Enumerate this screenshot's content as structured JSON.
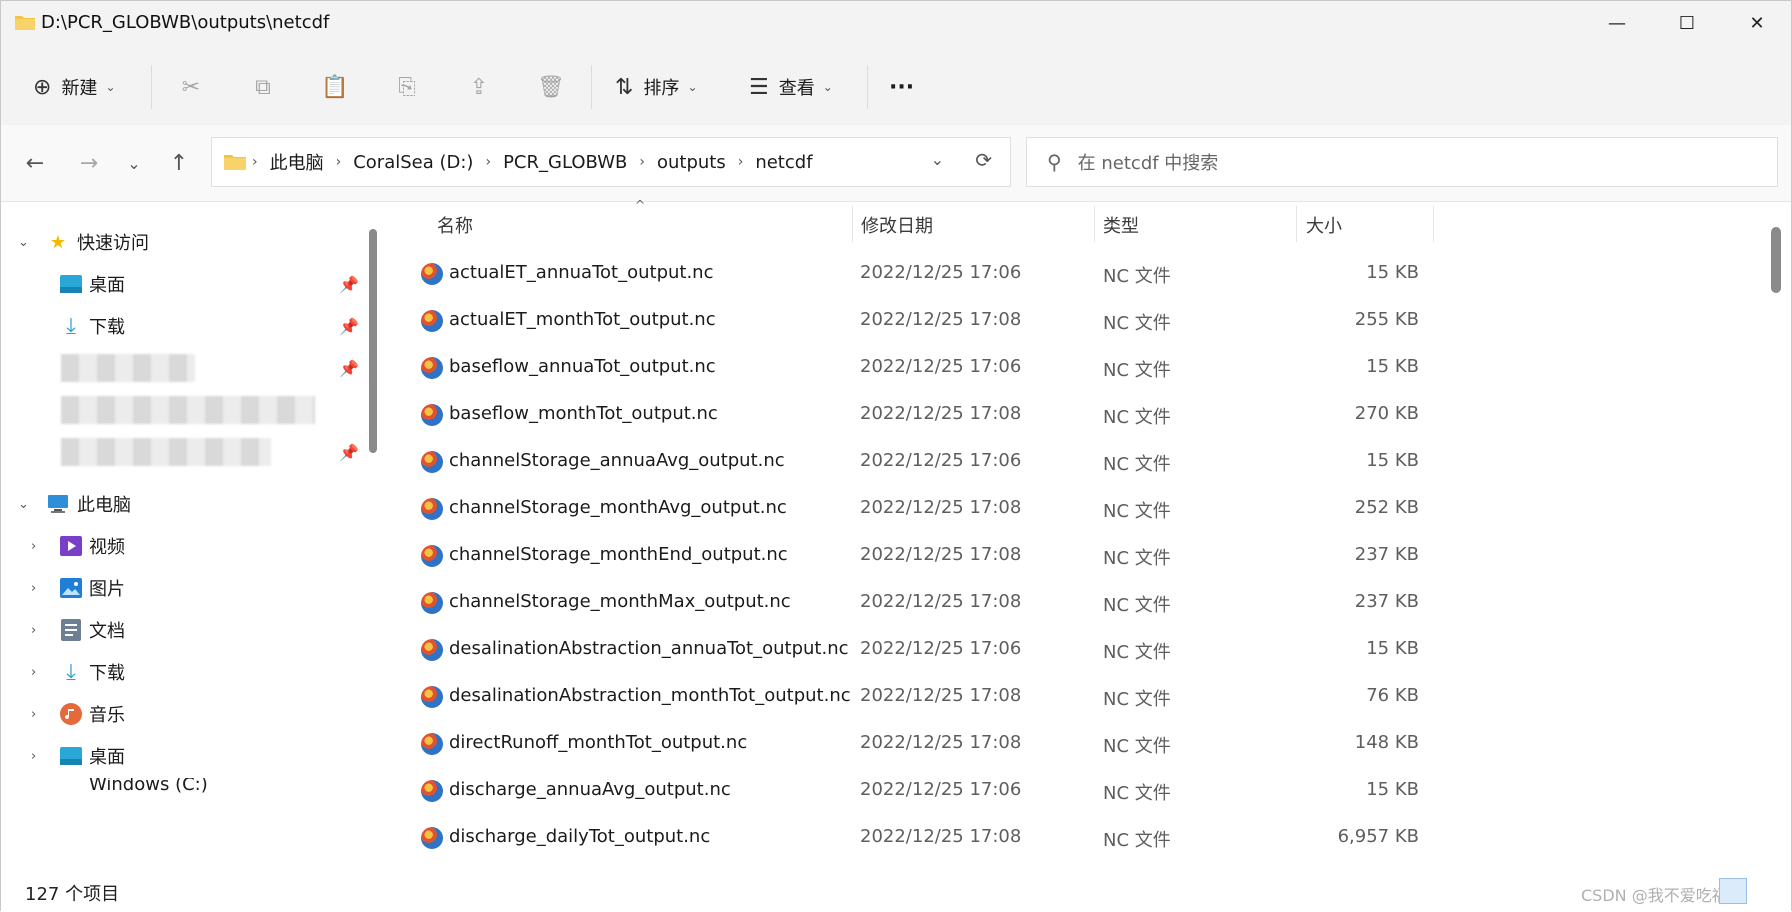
{
  "window": {
    "title": "D:\\PCR_GLOBWB\\outputs\\netcdf"
  },
  "toolbar": {
    "new_label": "新建",
    "sort_label": "排序",
    "view_label": "查看",
    "more_label": "···"
  },
  "icons": {
    "minimize": "—",
    "maximize": "☐",
    "close": "✕",
    "back": "←",
    "forward": "→",
    "recent": "⌄",
    "up": "↑",
    "new": "⊕",
    "cut": "✂",
    "copy": "⧉",
    "paste": "📋",
    "rename": "⎘",
    "share": "⇪",
    "delete": "🗑",
    "sort": "⇅",
    "view": "☰",
    "chevron_down": "⌄",
    "refresh": "⟳",
    "search": "⚲",
    "chevron_right": "›",
    "pin": "📌"
  },
  "address": {
    "crumbs": [
      "此电脑",
      "CoralSea (D:)",
      "PCR_GLOBWB",
      "outputs",
      "netcdf"
    ],
    "separator": "›"
  },
  "search": {
    "placeholder": "在 netcdf 中搜索"
  },
  "nav": {
    "quick_access": "快速访问",
    "quick_items": [
      "桌面",
      "下载"
    ],
    "this_pc": "此电脑",
    "pc_items": [
      "视频",
      "图片",
      "文档",
      "下载",
      "音乐",
      "桌面"
    ],
    "partial_item": "Windows (C:)"
  },
  "columns": {
    "name": "名称",
    "date": "修改日期",
    "type": "类型",
    "size": "大小"
  },
  "files": [
    {
      "name": "actualET_annuaTot_output.nc",
      "date": "2022/12/25 17:06",
      "type": "NC 文件",
      "size": "15 KB"
    },
    {
      "name": "actualET_monthTot_output.nc",
      "date": "2022/12/25 17:08",
      "type": "NC 文件",
      "size": "255 KB"
    },
    {
      "name": "baseflow_annuaTot_output.nc",
      "date": "2022/12/25 17:06",
      "type": "NC 文件",
      "size": "15 KB"
    },
    {
      "name": "baseflow_monthTot_output.nc",
      "date": "2022/12/25 17:08",
      "type": "NC 文件",
      "size": "270 KB"
    },
    {
      "name": "channelStorage_annuaAvg_output.nc",
      "date": "2022/12/25 17:06",
      "type": "NC 文件",
      "size": "15 KB"
    },
    {
      "name": "channelStorage_monthAvg_output.nc",
      "date": "2022/12/25 17:08",
      "type": "NC 文件",
      "size": "252 KB"
    },
    {
      "name": "channelStorage_monthEnd_output.nc",
      "date": "2022/12/25 17:08",
      "type": "NC 文件",
      "size": "237 KB"
    },
    {
      "name": "channelStorage_monthMax_output.nc",
      "date": "2022/12/25 17:08",
      "type": "NC 文件",
      "size": "237 KB"
    },
    {
      "name": "desalinationAbstraction_annuaTot_output.nc",
      "date": "2022/12/25 17:06",
      "type": "NC 文件",
      "size": "15 KB"
    },
    {
      "name": "desalinationAbstraction_monthTot_output.nc",
      "date": "2022/12/25 17:08",
      "type": "NC 文件",
      "size": "76 KB"
    },
    {
      "name": "directRunoff_monthTot_output.nc",
      "date": "2022/12/25 17:08",
      "type": "NC 文件",
      "size": "148 KB"
    },
    {
      "name": "discharge_annuaAvg_output.nc",
      "date": "2022/12/25 17:06",
      "type": "NC 文件",
      "size": "15 KB"
    },
    {
      "name": "discharge_dailyTot_output.nc",
      "date": "2022/12/25 17:08",
      "type": "NC 文件",
      "size": "6,957 KB"
    }
  ],
  "status": {
    "item_count": "127 个项目",
    "watermark": "CSDN @我不爱吃福瑞"
  }
}
